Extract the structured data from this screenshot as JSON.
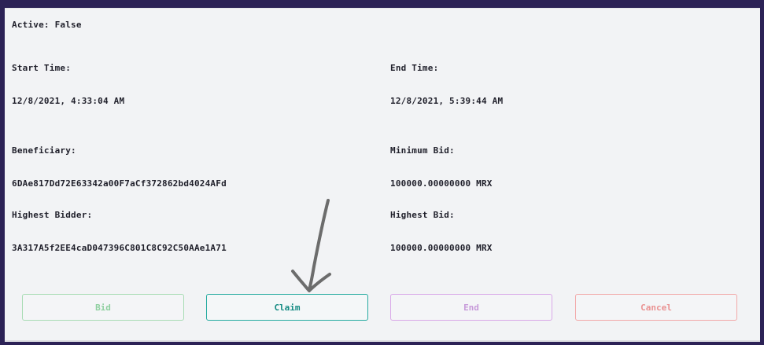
{
  "auction": {
    "active": "Active: False",
    "start_label": "Start Time:",
    "start_value": "12/8/2021, 4:33:04 AM",
    "end_label": "End Time:",
    "end_value": "12/8/2021, 5:39:44 AM",
    "beneficiary_label": "Beneficiary:",
    "beneficiary_value": "6DAe817Dd72E63342a00F7aCf372862bd4024AFd",
    "min_bid_label": "Minimum Bid:",
    "min_bid_value": "100000.00000000 MRX",
    "highest_bidder_label": "Highest Bidder:",
    "highest_bidder_value": "3A317A5f2EE4caD047396C801C8C92C50AAe1A71",
    "highest_bid_label": "Highest Bid:",
    "highest_bid_value": "100000.00000000 MRX"
  },
  "actions": {
    "bid": "Bid",
    "claim": "Claim",
    "end": "End",
    "cancel": "Cancel"
  },
  "colors": {
    "bid": "#8fd0a0",
    "claim": "#138a82",
    "end": "#c79ada",
    "cancel": "#ea9393",
    "frame": "#2c2256"
  },
  "annotation": {
    "icon": "hand-drawn-arrow-icon"
  }
}
